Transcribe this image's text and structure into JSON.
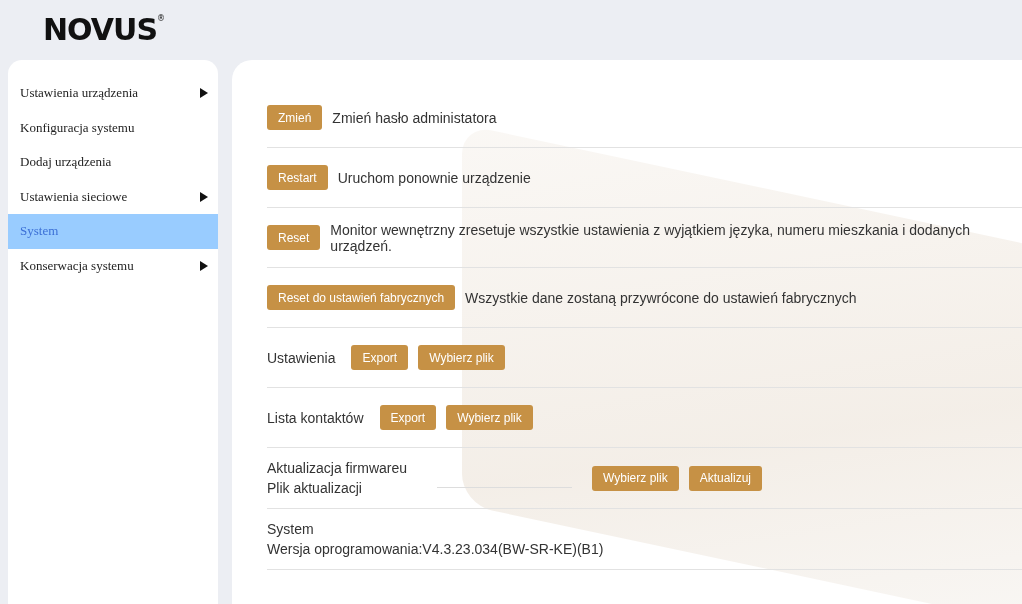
{
  "logo": {
    "text": "NOVUS",
    "mark": "®"
  },
  "sidebar": {
    "items": [
      {
        "label": "Ustawienia urządzenia",
        "selected": false,
        "has_submenu": true
      },
      {
        "label": "Konfiguracja systemu",
        "selected": false,
        "has_submenu": false
      },
      {
        "label": "Dodaj urządzenia",
        "selected": false,
        "has_submenu": false
      },
      {
        "label": "Ustawienia sieciowe",
        "selected": false,
        "has_submenu": true
      },
      {
        "label": "System",
        "selected": true,
        "has_submenu": false
      },
      {
        "label": "Konserwacja systemu",
        "selected": false,
        "has_submenu": true
      }
    ]
  },
  "rows": [
    {
      "kind": "action",
      "buttons": [
        "Zmień"
      ],
      "text": "Zmień hasło administatora"
    },
    {
      "kind": "action",
      "buttons": [
        "Restart"
      ],
      "text": "Uruchom ponownie urządzenie"
    },
    {
      "kind": "action",
      "buttons": [
        "Reset"
      ],
      "text": "Monitor wewnętrzny zresetuje wszystkie ustawienia z wyjątkiem języka, numeru mieszkania i dodanych urządzeń."
    },
    {
      "kind": "action",
      "buttons": [
        "Reset do ustawień fabrycznych"
      ],
      "text": "Wszystkie dane zostaną przywrócone do ustawień fabrycznych"
    },
    {
      "kind": "file",
      "label": "Ustawienia",
      "buttons": [
        "Export",
        "Wybierz plik"
      ]
    },
    {
      "kind": "file",
      "label": "Lista kontaktów",
      "buttons": [
        "Export",
        "Wybierz plik"
      ]
    },
    {
      "kind": "firmware",
      "label": "Aktualizacja firmwareu",
      "sublabel": "Plik aktualizacji",
      "buttons": [
        "Wybierz plik",
        "Aktualizuj"
      ]
    },
    {
      "kind": "info",
      "label": "System",
      "text": "Wersja oprogramowania:V4.3.23.034(BW-SR-KE)(B1)"
    }
  ]
}
